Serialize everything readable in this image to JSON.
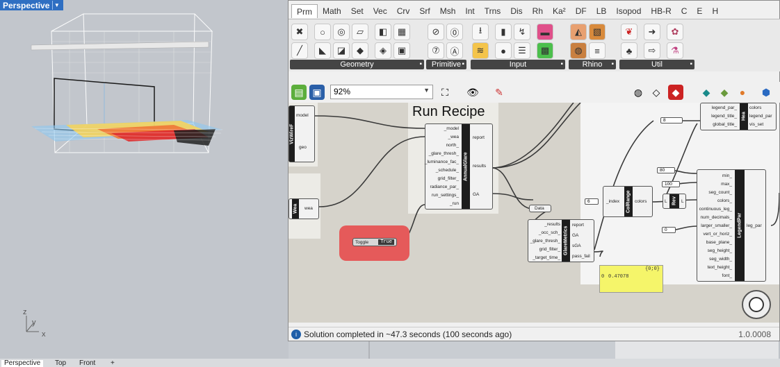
{
  "viewport": {
    "label": "Perspective",
    "axes": {
      "z": "z",
      "y": "y",
      "x": "x"
    }
  },
  "bottom_tabs": [
    "Perspective",
    "Top",
    "Front",
    "+"
  ],
  "gh": {
    "tabs": [
      "Prm",
      "Math",
      "Set",
      "Vec",
      "Crv",
      "Srf",
      "Msh",
      "Int",
      "Trns",
      "Dis",
      "Rh",
      "Ka²",
      "DF",
      "LB",
      "Isopod",
      "HB-R",
      "C",
      "E",
      "H"
    ],
    "ribbon_groups": [
      "Geometry",
      "Primitive",
      "Input",
      "Rhino",
      "Util"
    ],
    "zoom": "92%",
    "canvas": {
      "title": "Run Recipe",
      "annual_glare": {
        "name": "AnnualGlare",
        "inputs": [
          "_model",
          "_wea",
          "north_",
          "_glare_thresh_",
          "_luminance_fac_",
          "_schedule_",
          "grid_filter_",
          "radiance_par_",
          "run_settings_",
          "_run"
        ],
        "outputs": [
          "report",
          "results",
          "GA"
        ]
      },
      "glare_metrics": {
        "name": "GlareMetrics",
        "inputs": [
          "_results",
          "_occ_sch_",
          "_glare_thresh_",
          "grid_filter_",
          "_target_time_"
        ],
        "outputs": [
          "report",
          "GA",
          "sGA",
          "pass_fail"
        ]
      },
      "legend_par": {
        "name": "LegendPar",
        "inputs": [
          "min_",
          "max_",
          "seg_count_",
          "colors_",
          "continuous_leg_",
          "num_decimals_",
          "larger_smaller_",
          "vert_or_horiz_",
          "base_plane_",
          "seg_height_",
          "seg_width_",
          "text_height_",
          "font_"
        ],
        "outputs": [
          "leg_par"
        ]
      },
      "col_range": {
        "name": "ColRange",
        "inputs": [
          "_index"
        ],
        "outputs": [
          "colors"
        ]
      },
      "rev": {
        "name": "Rev",
        "inputs": [
          "L"
        ],
        "outputs": [
          "L"
        ]
      },
      "heat": {
        "name": "Hea",
        "inputs": [
          "legend_par_",
          "legend_title_",
          "global_title_"
        ],
        "outputs": [
          "colors",
          "legend_par",
          "vis_set"
        ]
      },
      "vizwire": {
        "name": "VizWireF",
        "outputs": [
          "model",
          "geo"
        ]
      },
      "wea": {
        "name": "Wea",
        "outputs": [
          "wea"
        ]
      },
      "toggle": {
        "label": "Toggle",
        "value": "True"
      },
      "data_param": "Data",
      "panel": {
        "header": "{0;0}",
        "row_index": "0",
        "value": "0.47078"
      },
      "sliders": {
        "eight": "8",
        "eighty": "80",
        "hundred": "100",
        "six": "6",
        "zero": "0"
      }
    },
    "status": "Solution completed in ~47.3 seconds (100 seconds ago)",
    "version": "1.0.0008"
  },
  "colors": {
    "toggle_highlight": "#e55a5a",
    "panel_yellow": "#f5f56a",
    "rhino_label": "#2f6fc2"
  }
}
